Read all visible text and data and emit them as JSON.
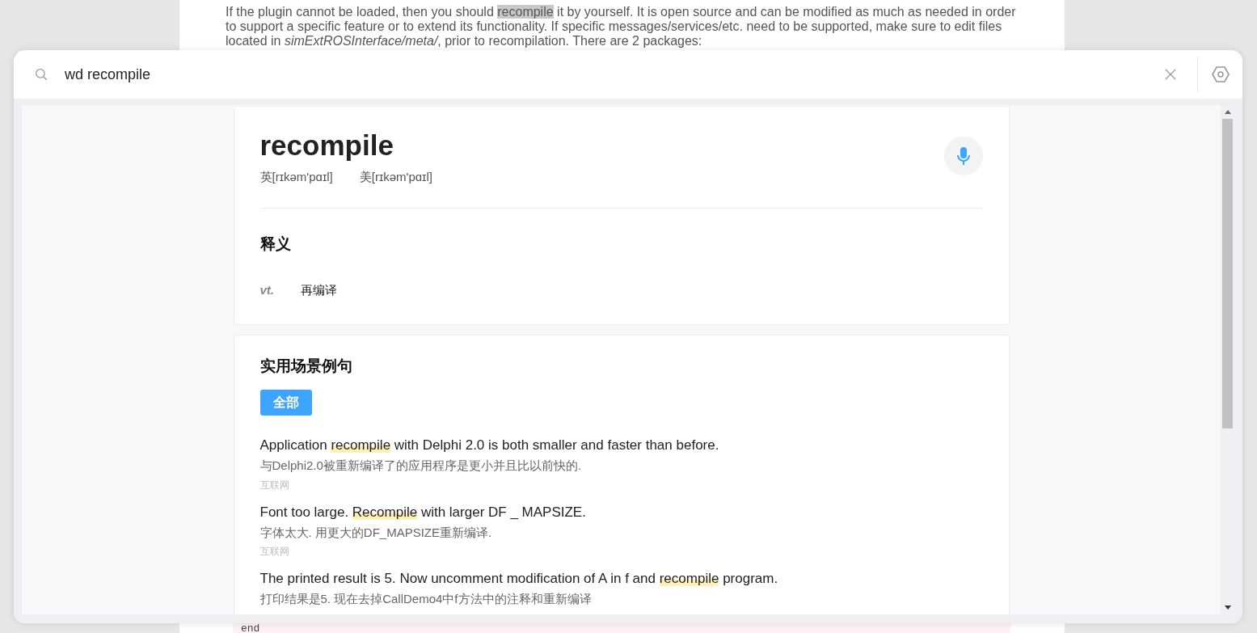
{
  "article": {
    "paragraph": [
      {
        "text": "If the plugin cannot be loaded, then you should ",
        "kind": "plain"
      },
      {
        "text": "recompile",
        "kind": "selected"
      },
      {
        "text": " it by yourself. It is open source and can be modified as much as needed in order to support a specific feature or to extend its functionality. If specific messages/services/etc. need to be supported, make sure to edit files located in ",
        "kind": "plain"
      },
      {
        "text": "simExtROSInterface/meta/",
        "kind": "italic"
      },
      {
        "text": ", prior to recompilation. There are 2 packages:",
        "kind": "plain"
      }
    ],
    "code": "end"
  },
  "search": {
    "value": "wd recompile"
  },
  "word": {
    "headword": "recompile",
    "phonetics": [
      "英[rɪkəm'pɑɪl]",
      "美[rɪkəm'pɑɪl]"
    ],
    "definitions_title": "释义",
    "definitions": [
      {
        "pos": "vt.",
        "meaning": "再编译"
      }
    ]
  },
  "examples": {
    "title": "实用场景例句",
    "filters": [
      {
        "label": "全部",
        "selected": true
      }
    ],
    "items": [
      {
        "en": [
          {
            "text": "Application ",
            "highlight": false
          },
          {
            "text": "recompile",
            "highlight": true
          },
          {
            "text": " with Delphi 2.0 is both smaller and faster than before.",
            "highlight": false
          }
        ],
        "zh": "与Delphi2.0被重新编译了的应用程序是更小并且比以前快的.",
        "source": "互联网"
      },
      {
        "en": [
          {
            "text": "Font too large. ",
            "highlight": false
          },
          {
            "text": "Recompile",
            "highlight": true
          },
          {
            "text": " with larger DF _ MAPSIZE.",
            "highlight": false
          }
        ],
        "zh": "字体太大. 用更大的DF_MAPSIZE重新编译.",
        "source": "互联网"
      },
      {
        "en": [
          {
            "text": "The printed result is 5. Now uncomment modification of A in f and ",
            "highlight": false
          },
          {
            "text": "recompile",
            "highlight": true
          },
          {
            "text": " program.",
            "highlight": false
          }
        ],
        "zh": "打印结果是5. 现在去掉CallDemo4中f方法中的注释和重新编译"
      }
    ]
  }
}
